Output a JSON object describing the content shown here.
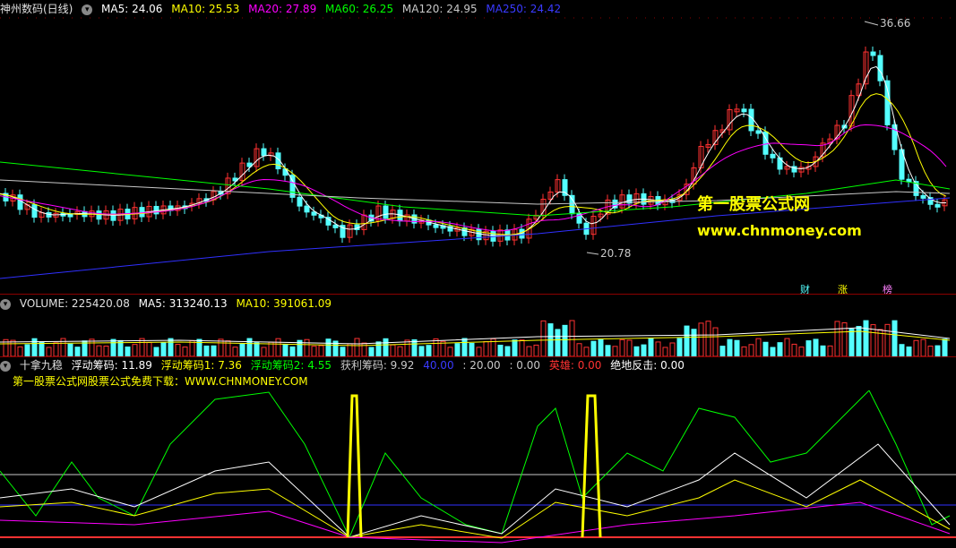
{
  "title": {
    "name": "神州数码(日线)"
  },
  "ma": {
    "ma5": "MA5: 24.06",
    "ma10": "MA10: 25.53",
    "ma20": "MA20: 27.89",
    "ma60": "MA60: 26.25",
    "ma120": "MA120: 24.95",
    "ma250": "MA250: 24.42"
  },
  "price": {
    "high": "36.66",
    "low": "20.78"
  },
  "watermark": {
    "line1": "第一股票公式网",
    "line2": "www.chnmoney.com"
  },
  "badges": {
    "cai": "财",
    "zhang": "涨",
    "bang": "榜"
  },
  "volume": {
    "vol": "VOLUME: 225420.08",
    "ma5": "MA5: 313240.13",
    "ma10": "MA10: 391061.09"
  },
  "indicator": {
    "name": "十拿九稳",
    "f0": "浮动筹码: 11.89",
    "f1": "浮动筹码1: 7.36",
    "f2": "浮动筹码2: 4.55",
    "profit": "获利筹码: 9.92",
    "v40": "40.00",
    "v20": ": 20.00",
    "v0": ": 0.00",
    "hero": "英雄: 0.00",
    "counter": "绝地反击: 0.00",
    "promo": "第一股票公式网股票公式免费下载：WWW.CHNMONEY.COM"
  },
  "colors": {
    "up": "#ff3232",
    "down": "#54ffff",
    "ma5": "#ffffff",
    "ma10": "#ffff00",
    "ma20": "#ff00ff",
    "ma60": "#00ff00",
    "ma120": "#c8c8c8",
    "ma250": "#3030ff"
  }
}
